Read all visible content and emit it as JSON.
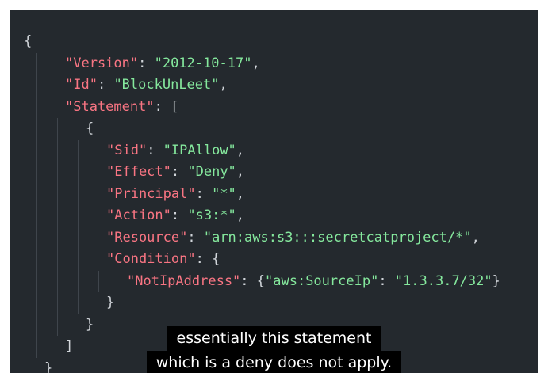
{
  "code": {
    "lines": [
      {
        "indent": 0,
        "guides": [],
        "tokens": [
          {
            "t": "punc",
            "v": "{"
          }
        ]
      },
      {
        "indent": 2,
        "guides": [
          34
        ],
        "tokens": [
          {
            "t": "key",
            "v": "\"Version\""
          },
          {
            "t": "punc",
            "v": ": "
          },
          {
            "t": "val",
            "v": "\"2012-10-17\""
          },
          {
            "t": "punc",
            "v": ","
          }
        ]
      },
      {
        "indent": 2,
        "guides": [
          34
        ],
        "tokens": [
          {
            "t": "key",
            "v": "\"Id\""
          },
          {
            "t": "punc",
            "v": ": "
          },
          {
            "t": "val",
            "v": "\"BlockUnLeet\""
          },
          {
            "t": "punc",
            "v": ","
          }
        ]
      },
      {
        "indent": 2,
        "guides": [
          34
        ],
        "tokens": [
          {
            "t": "key",
            "v": "\"Statement\""
          },
          {
            "t": "punc",
            "v": ": ["
          }
        ]
      },
      {
        "indent": 3,
        "guides": [
          34,
          60
        ],
        "tokens": [
          {
            "t": "punc",
            "v": "{"
          }
        ]
      },
      {
        "indent": 4,
        "guides": [
          34,
          60,
          86
        ],
        "tokens": [
          {
            "t": "key",
            "v": "\"Sid\""
          },
          {
            "t": "punc",
            "v": ": "
          },
          {
            "t": "val",
            "v": "\"IPAllow\""
          },
          {
            "t": "punc",
            "v": ","
          }
        ]
      },
      {
        "indent": 4,
        "guides": [
          34,
          60,
          86
        ],
        "tokens": [
          {
            "t": "key",
            "v": "\"Effect\""
          },
          {
            "t": "punc",
            "v": ": "
          },
          {
            "t": "val",
            "v": "\"Deny\""
          },
          {
            "t": "punc",
            "v": ","
          }
        ]
      },
      {
        "indent": 4,
        "guides": [
          34,
          60,
          86
        ],
        "tokens": [
          {
            "t": "key",
            "v": "\"Principal\""
          },
          {
            "t": "punc",
            "v": ": "
          },
          {
            "t": "val",
            "v": "\"*\""
          },
          {
            "t": "punc",
            "v": ","
          }
        ]
      },
      {
        "indent": 4,
        "guides": [
          34,
          60,
          86
        ],
        "tokens": [
          {
            "t": "key",
            "v": "\"Action\""
          },
          {
            "t": "punc",
            "v": ": "
          },
          {
            "t": "val",
            "v": "\"s3:*\""
          },
          {
            "t": "punc",
            "v": ","
          }
        ]
      },
      {
        "indent": 4,
        "guides": [
          34,
          60,
          86
        ],
        "tokens": [
          {
            "t": "key",
            "v": "\"Resource\""
          },
          {
            "t": "punc",
            "v": ": "
          },
          {
            "t": "val",
            "v": "\"arn:aws:s3:::secretcatproject/*\""
          },
          {
            "t": "punc",
            "v": ","
          }
        ]
      },
      {
        "indent": 4,
        "guides": [
          34,
          60,
          86
        ],
        "tokens": [
          {
            "t": "key",
            "v": "\"Condition\""
          },
          {
            "t": "punc",
            "v": ": {"
          }
        ]
      },
      {
        "indent": 5,
        "guides": [
          34,
          60,
          86,
          112
        ],
        "tokens": [
          {
            "t": "key",
            "v": "\"NotIpAddress\""
          },
          {
            "t": "punc",
            "v": ": {"
          },
          {
            "t": "val",
            "v": "\"aws:SourceIp\""
          },
          {
            "t": "punc",
            "v": ": "
          },
          {
            "t": "val",
            "v": "\"1.3.3.7/32\""
          },
          {
            "t": "punc",
            "v": "}"
          }
        ]
      },
      {
        "indent": 4,
        "guides": [
          34,
          60,
          86
        ],
        "tokens": [
          {
            "t": "punc",
            "v": "}"
          }
        ]
      },
      {
        "indent": 3,
        "guides": [
          34,
          60
        ],
        "tokens": [
          {
            "t": "punc",
            "v": "}"
          }
        ]
      },
      {
        "indent": 2,
        "guides": [
          34
        ],
        "tokens": [
          {
            "t": "punc",
            "v": "]"
          }
        ]
      },
      {
        "indent": 1,
        "guides": [],
        "tokens": [
          {
            "t": "punc",
            "v": "}"
          }
        ]
      }
    ]
  },
  "captions": {
    "line1": "essentially this statement",
    "line2": "which is a deny does not apply."
  }
}
